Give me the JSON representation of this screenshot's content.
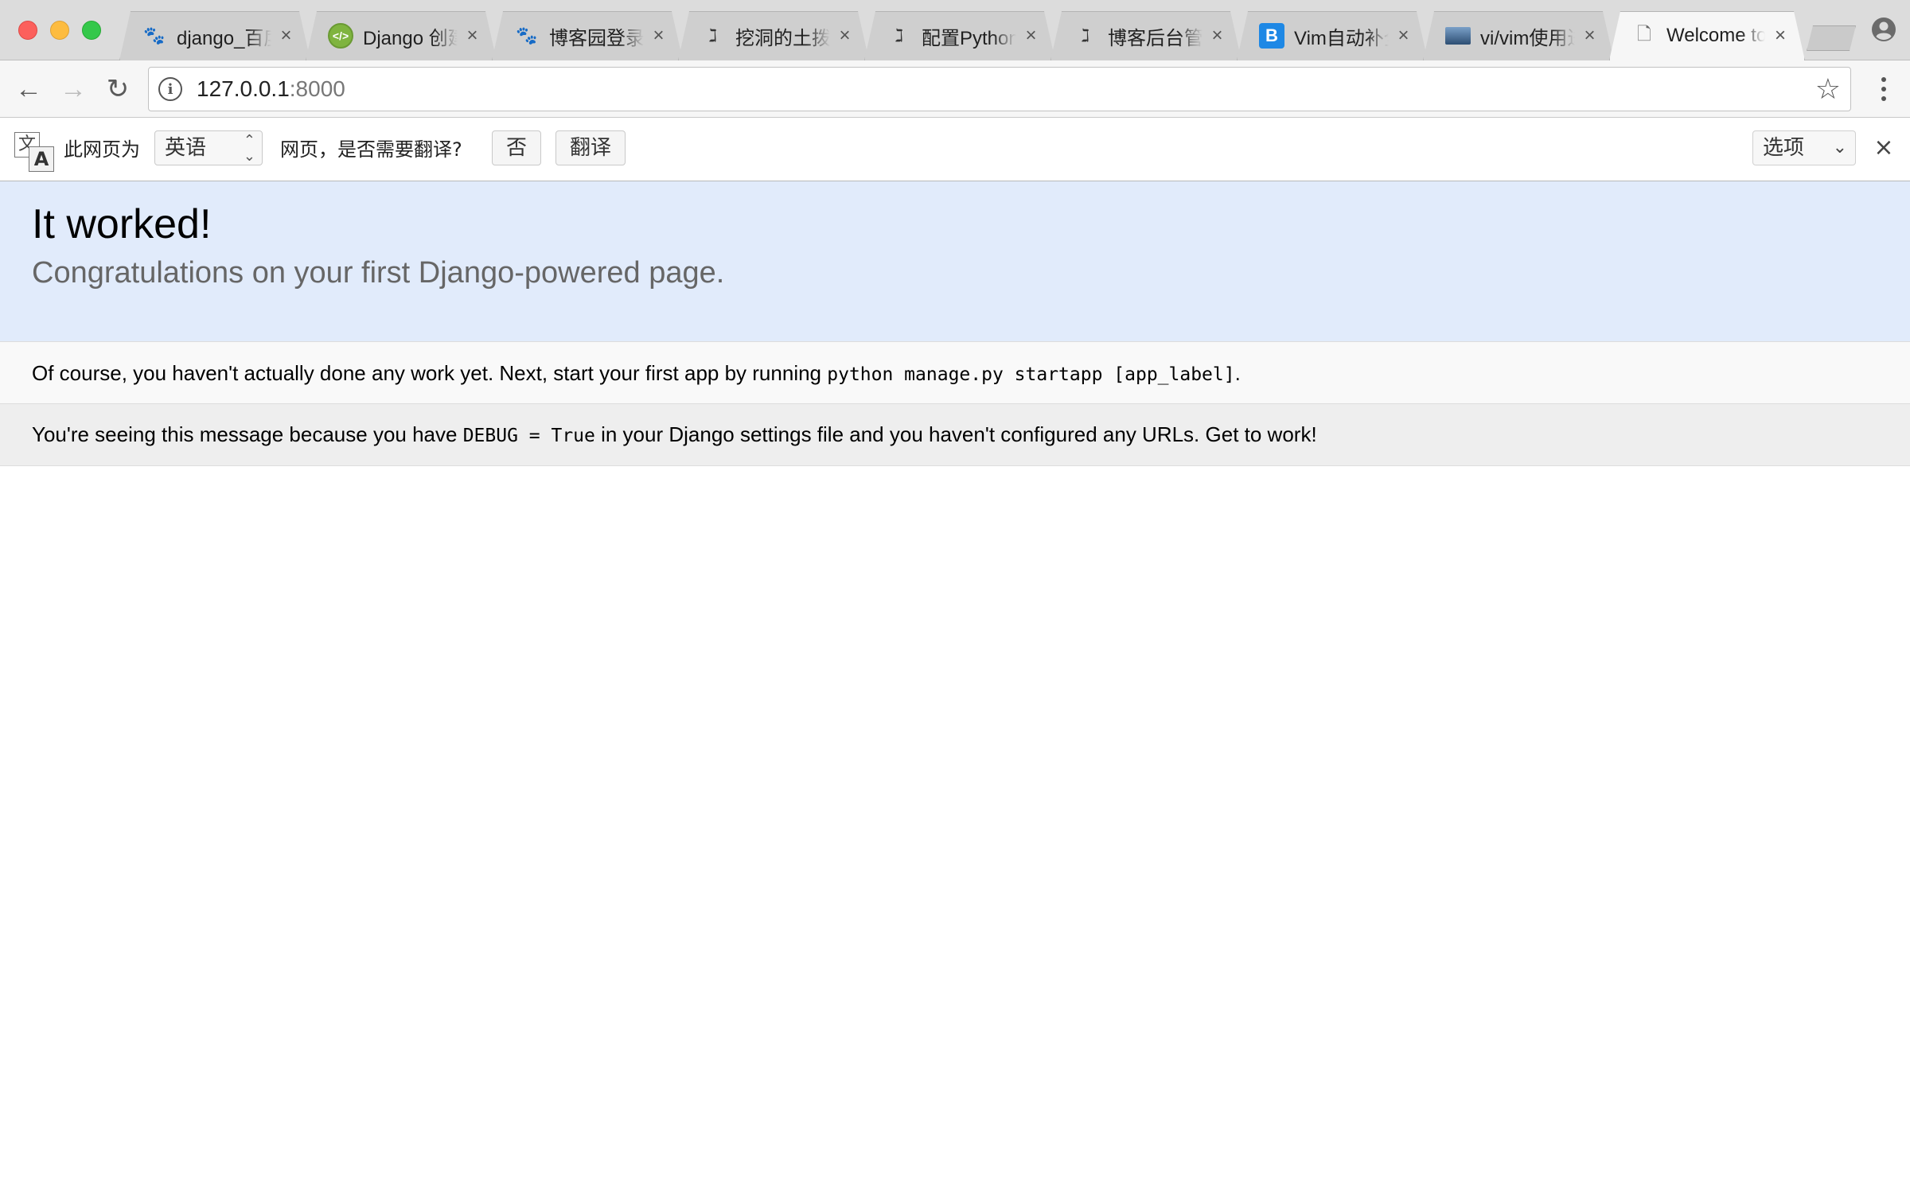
{
  "window": {
    "tabs": [
      {
        "title": "django_百度一下",
        "favicon": "baidu-paw-icon",
        "close": "×"
      },
      {
        "title": "Django 创建第一个项目",
        "favicon": "django-code-icon",
        "close": "×"
      },
      {
        "title": "博客园登录_百度搜索",
        "favicon": "baidu-paw-icon",
        "close": "×"
      },
      {
        "title": "挖洞的土拨鼠",
        "favicon": "jianshu-icon",
        "close": "×"
      },
      {
        "title": "配置Python开发环境",
        "favicon": "jianshu-icon",
        "close": "×"
      },
      {
        "title": "博客后台管理",
        "favicon": "jianshu-icon",
        "close": "×"
      },
      {
        "title": "Vim自动补全插件",
        "favicon": "blog-b-icon",
        "close": "×"
      },
      {
        "title": "vi/vim使用进阶",
        "favicon": "image-thumbnail-icon",
        "close": "×"
      },
      {
        "title": "Welcome to Django",
        "favicon": "page-icon",
        "close": "×",
        "active": true
      }
    ]
  },
  "toolbar": {
    "back": "←",
    "forward": "→",
    "reload": "↻",
    "info": "i",
    "url_host": "127.0.0.1",
    "url_port": ":8000",
    "star": "☆"
  },
  "translate_bar": {
    "icon_chinese": "文",
    "icon_latin": "A",
    "prefix": "此网页为",
    "language": "英语",
    "question": "网页，是否需要翻译?",
    "no_label": "否",
    "translate_label": "翻译",
    "options_label": "选项",
    "close": "×"
  },
  "content": {
    "title": "It worked!",
    "subtitle": "Congratulations on your first Django-powered page.",
    "instructions_pre": "Of course, you haven't actually done any work yet. Next, start your first app by running ",
    "instructions_code": "python manage.py startapp [app_label]",
    "instructions_post": ".",
    "explanation_pre": "You're seeing this message because you have ",
    "explanation_code": "DEBUG = True",
    "explanation_post": " in your Django settings file and you haven't configured any URLs. Get to work!"
  },
  "colors": {
    "summary_bg": "#e1ebfb",
    "instructions_bg": "#f9f9f9",
    "explanation_bg": "#eeeeee"
  }
}
